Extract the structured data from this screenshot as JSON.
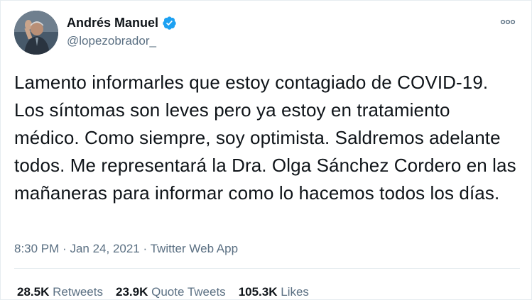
{
  "author": {
    "display_name": "Andrés Manuel",
    "handle": "@lopezobrador_",
    "verified": true
  },
  "tweet": {
    "text": "Lamento informarles que estoy contagiado de COVID-19. Los síntomas son leves pero ya estoy en tratamiento médico. Como siempre, soy optimista. Saldremos adelante todos. Me representará la Dra. Olga Sánchez Cordero en las mañaneras para informar como lo hacemos todos los días.",
    "time": "8:30 PM",
    "date": "Jan 24, 2021",
    "separator": "·",
    "source": "Twitter Web App"
  },
  "stats": {
    "retweets_count": "28.5K",
    "retweets_label": "Retweets",
    "quotes_count": "23.9K",
    "quotes_label": "Quote Tweets",
    "likes_count": "105.3K",
    "likes_label": "Likes"
  },
  "icons": {
    "verified": "verified-badge-icon",
    "more": "more-options-icon"
  },
  "colors": {
    "verified_blue": "#1da1f2",
    "secondary_text": "#5b7083",
    "primary_text": "#0f1419",
    "divider": "#e6ecf0"
  }
}
